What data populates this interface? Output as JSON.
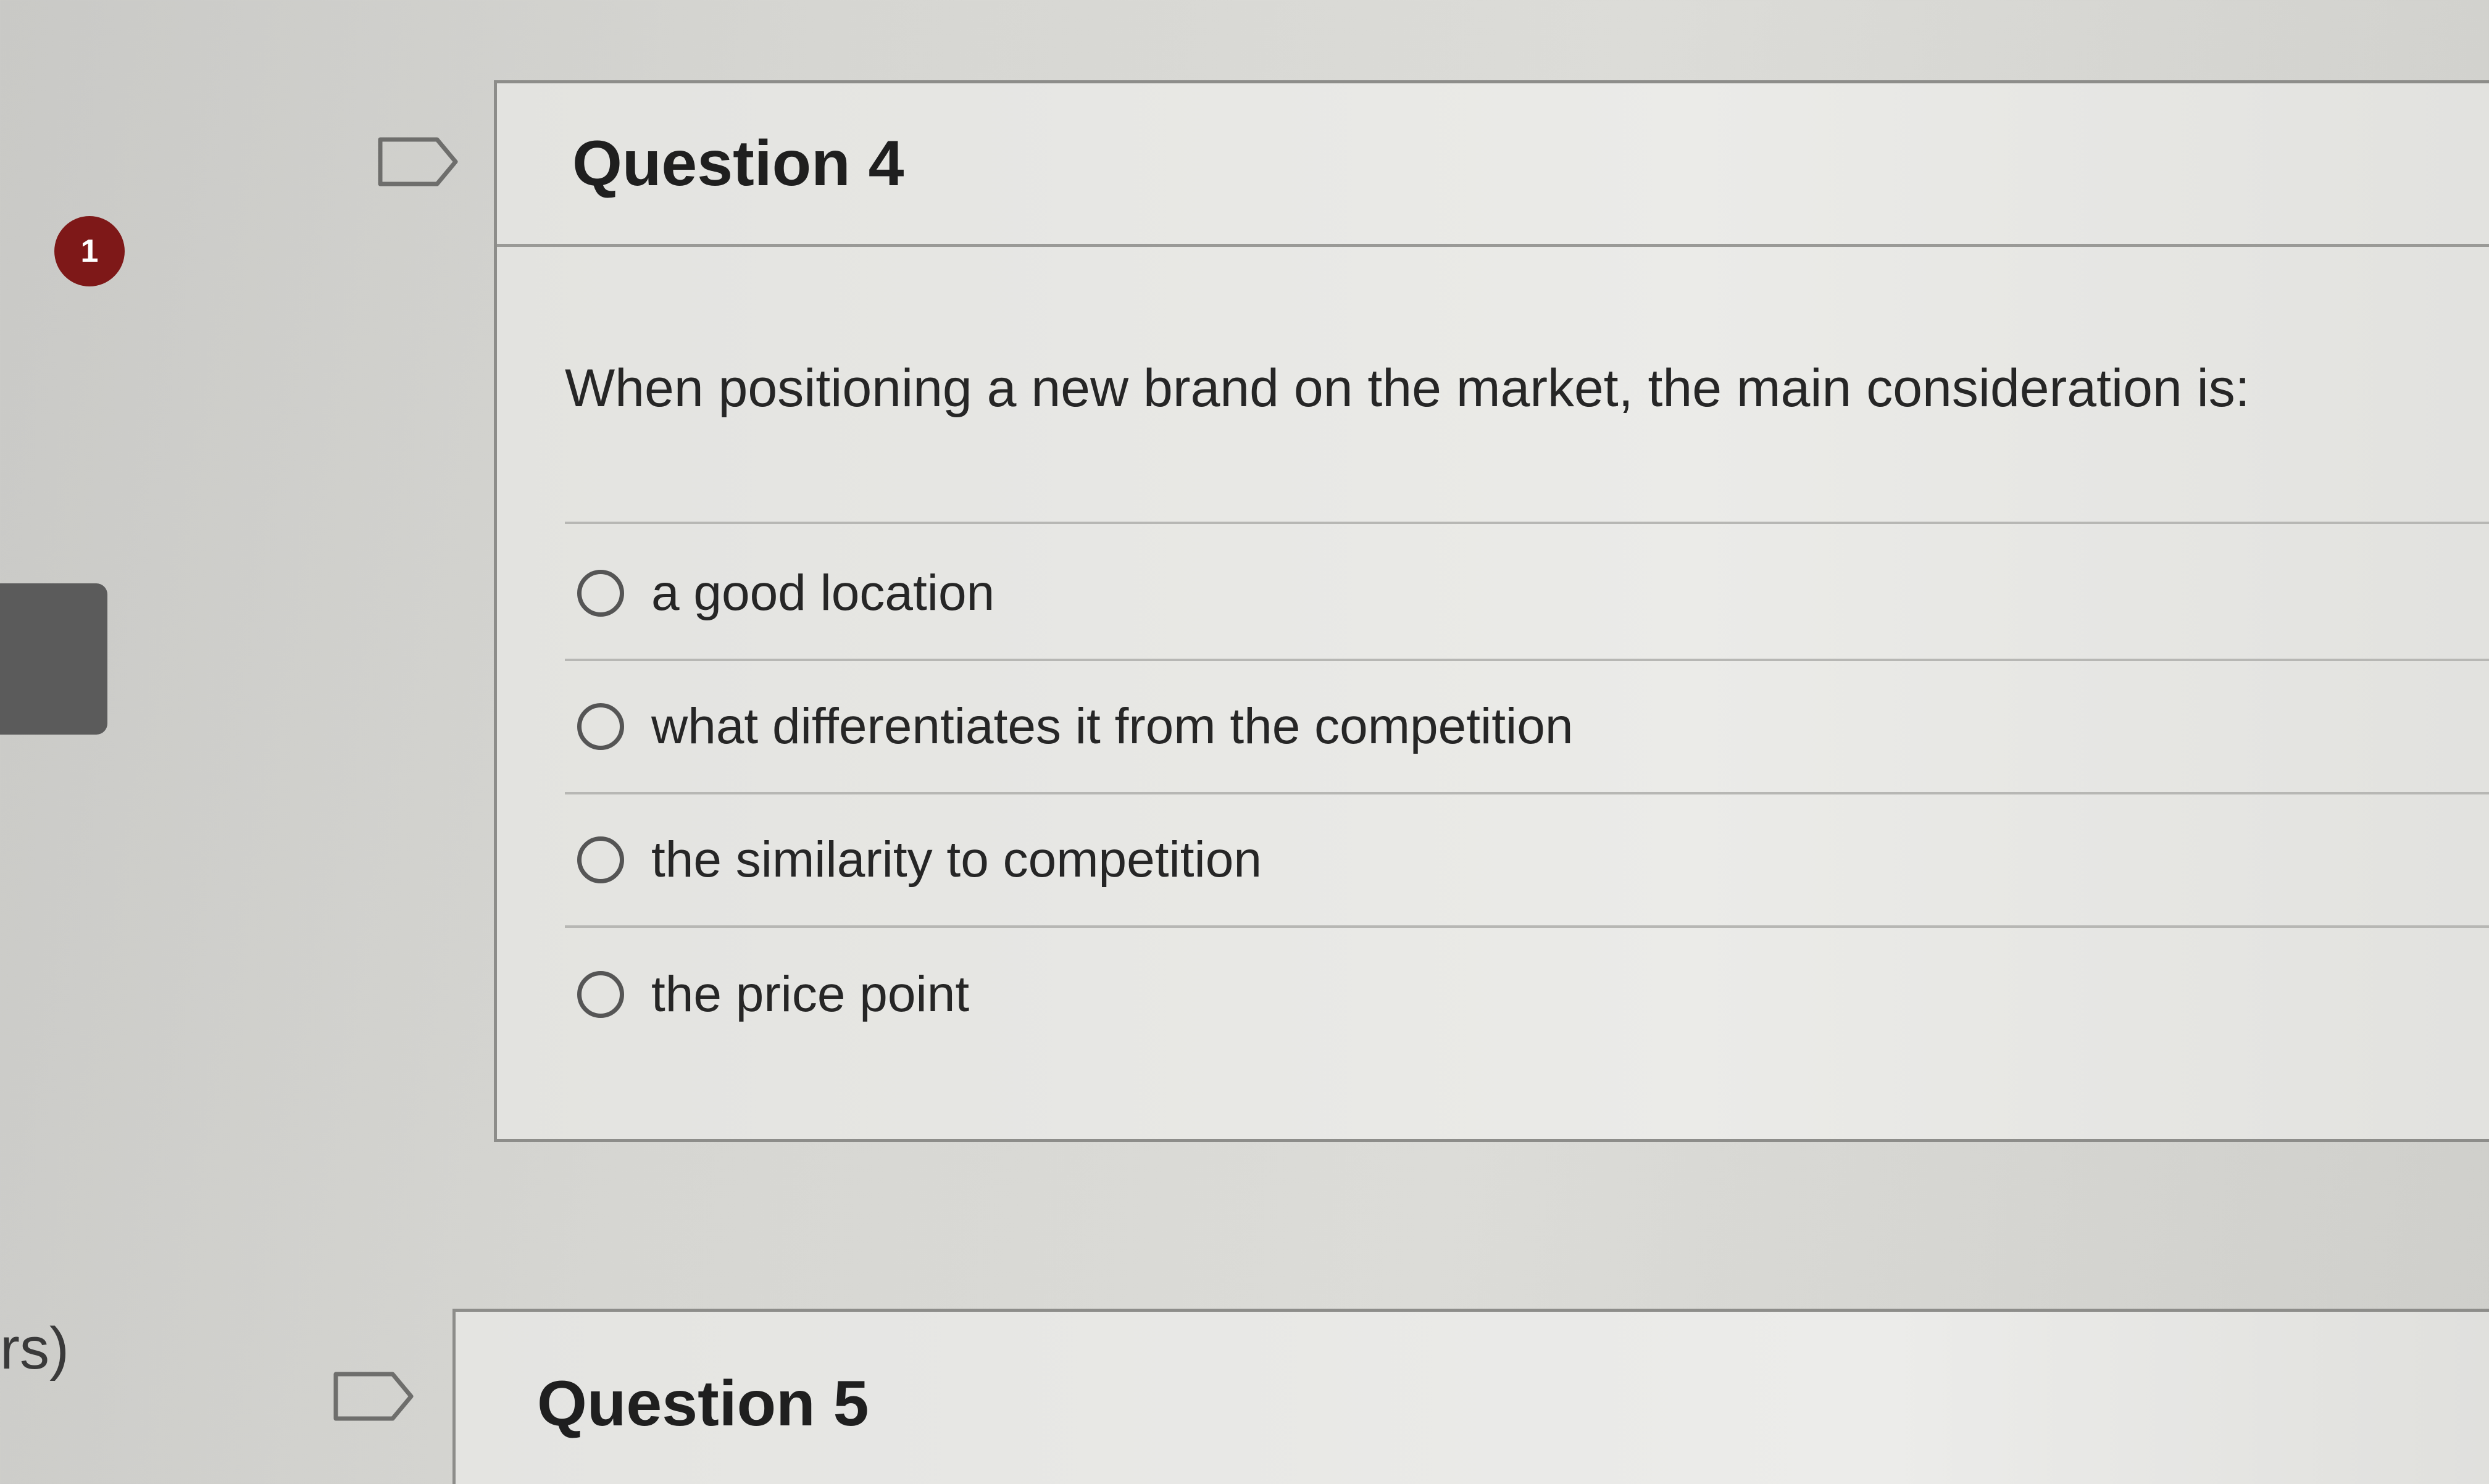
{
  "sidebar": {
    "badge_count": "1",
    "fragment_text": "rs)"
  },
  "questions": [
    {
      "title": "Question 4",
      "prompt": "When positioning a new brand on the market, the main consideration is:",
      "options": [
        "a good location",
        "what differentiates it from the competition",
        "the similarity to competition",
        "the price point"
      ]
    },
    {
      "title": "Question 5"
    }
  ],
  "colors": {
    "badge": "#7e1818",
    "card_border": "#8d8d8a",
    "background": "#d6d6d2"
  },
  "icons": {
    "bookmark": "bookmark-flag-icon",
    "radio": "radio-unchecked-icon"
  }
}
